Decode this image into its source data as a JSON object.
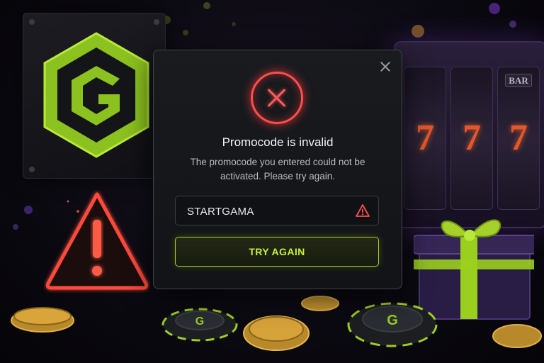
{
  "modal": {
    "title": "Promocode is invalid",
    "message": "The promocode you entered could not be activated. Please try again.",
    "promo_input": {
      "value": "STARTGAMA",
      "placeholder": ""
    },
    "try_again_label": "TRY AGAIN",
    "close_icon": "close-icon",
    "error_icon": "error-circle-x-icon",
    "field_warning_icon": "warning-triangle-icon"
  },
  "background": {
    "slot_symbols": [
      "BAR",
      "7",
      "7"
    ],
    "logo_letter": "G",
    "chip_letter": "G"
  },
  "colors": {
    "accent": "#a6d12b",
    "error": "#ff4d4d",
    "modal_bg": "#17181b",
    "text": "#f1f2f4",
    "muted": "#b9bcc2"
  }
}
